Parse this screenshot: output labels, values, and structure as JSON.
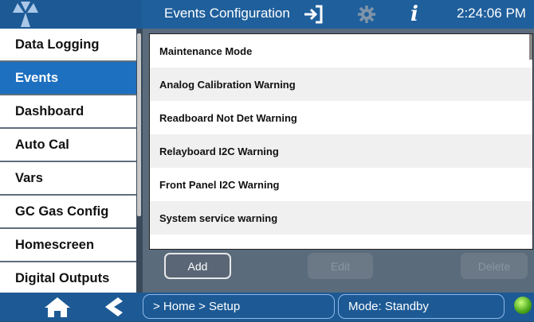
{
  "header": {
    "title": "Events Configuration",
    "time": "2:24:06 PM",
    "icons": [
      "logo-icon",
      "exit-icon",
      "gear-icon",
      "info-icon"
    ]
  },
  "sidebar": {
    "items": [
      {
        "label": "Data Logging",
        "active": false
      },
      {
        "label": "Events",
        "active": true
      },
      {
        "label": "Dashboard",
        "active": false
      },
      {
        "label": "Auto Cal",
        "active": false
      },
      {
        "label": "Vars",
        "active": false
      },
      {
        "label": "GC Gas Config",
        "active": false
      },
      {
        "label": "Homescreen",
        "active": false
      },
      {
        "label": "Digital Outputs",
        "active": false
      }
    ]
  },
  "events": {
    "rows": [
      "Maintenance Mode",
      "Analog Calibration Warning",
      "Readboard Not Det Warning",
      "Relayboard I2C Warning",
      "Front Panel I2C Warning",
      "System service warning"
    ]
  },
  "buttons": {
    "add": "Add",
    "edit": "Edit",
    "delete": "Delete"
  },
  "footer": {
    "breadcrumb": "> Home > Setup",
    "mode": "Mode: Standby",
    "icons": [
      "home-icon",
      "back-icon",
      "status-indicator-icon"
    ],
    "status_color": "#4aa51a"
  },
  "colors": {
    "accent": "#1d6fc0",
    "header": "#1f5f9c"
  }
}
